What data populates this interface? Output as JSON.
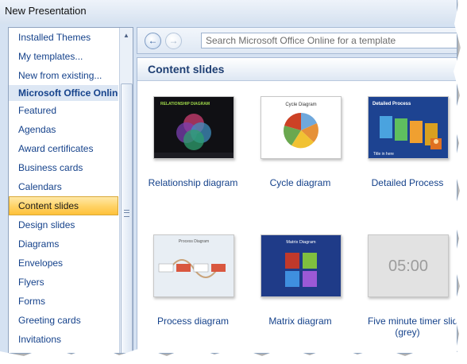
{
  "window": {
    "title": "New Presentation"
  },
  "sidebar": {
    "items": [
      {
        "label": "Installed Themes",
        "type": "item"
      },
      {
        "label": "My templates...",
        "type": "item"
      },
      {
        "label": "New from existing...",
        "type": "item"
      },
      {
        "label": "Microsoft Office Online",
        "type": "section"
      },
      {
        "label": "Featured",
        "type": "item"
      },
      {
        "label": "Agendas",
        "type": "item"
      },
      {
        "label": "Award certificates",
        "type": "item"
      },
      {
        "label": "Business cards",
        "type": "item"
      },
      {
        "label": "Calendars",
        "type": "item"
      },
      {
        "label": "Content slides",
        "type": "item",
        "selected": true
      },
      {
        "label": "Design slides",
        "type": "item"
      },
      {
        "label": "Diagrams",
        "type": "item"
      },
      {
        "label": "Envelopes",
        "type": "item"
      },
      {
        "label": "Flyers",
        "type": "item"
      },
      {
        "label": "Forms",
        "type": "item"
      },
      {
        "label": "Greeting cards",
        "type": "item"
      },
      {
        "label": "Invitations",
        "type": "item"
      }
    ]
  },
  "toolbar": {
    "search_placeholder": "Search Microsoft Office Online for a template"
  },
  "main": {
    "title": "Content slides",
    "templates": [
      {
        "label": "Relationship diagram",
        "thumb_title": "RELATIONSHIP DIAGRAM"
      },
      {
        "label": "Cycle diagram",
        "thumb_title": "Cycle Diagram"
      },
      {
        "label": "Detailed Process",
        "thumb_title": "Detailed Process",
        "thumb_caption": "Title in here"
      },
      {
        "label": "Process diagram",
        "thumb_title": "Process Diagram"
      },
      {
        "label": "Matrix diagram",
        "thumb_title": "Matrix Diagram"
      },
      {
        "label": "Five minute timer slide",
        "label2": "(grey)",
        "thumb_title": "05:00"
      }
    ]
  },
  "colors": {
    "selected_gradient_top": "#ffe9a8",
    "selected_gradient_bottom": "#ffc13a",
    "link_text": "#15428b",
    "window_bg": "#d5e2f2"
  }
}
